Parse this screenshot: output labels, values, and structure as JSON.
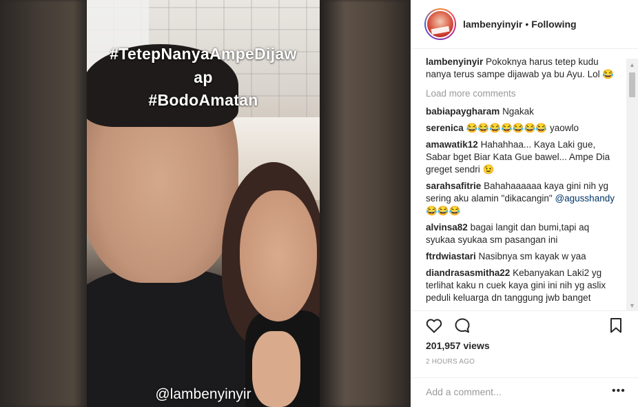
{
  "story": {
    "caption_line1": "#TetepNanyaAmpeDijaw",
    "caption_line2": "ap",
    "caption_line3": "#BodoAmatan",
    "handle": "@lambenyinyir"
  },
  "header": {
    "username": "lambenyinyir",
    "separator": "•",
    "follow_status": "Following"
  },
  "caption": {
    "username": "lambenyinyir",
    "text": "Pokoknya harus tetep kudu nanya terus sampe dijawab ya bu Ayu. Lol 😂"
  },
  "load_more": "Load more comments",
  "comments": [
    {
      "username": "babiapaygharam",
      "text": "Ngakak"
    },
    {
      "username": "serenica",
      "text": "😂😂😂😂😂😂😂 yaowlo"
    },
    {
      "username": "amawatik12",
      "text": "Hahahhaa... Kaya Laki gue, Sabar bget Biar Kata Gue bawel... Ampe Dia greget sendri 😉"
    },
    {
      "username": "sarahsafitrie",
      "text": "Bahahaaaaaa kaya gini nih yg sering aku alamin \"dikacangin\"",
      "mention": "@agusshandy",
      "after": "😂😂😂"
    },
    {
      "username": "alvinsa82",
      "text": "bagai langit dan bumi,tapi aq syukaa syukaa sm pasangan ini"
    },
    {
      "username": "ftrdwiastari",
      "text": "Nasibnya sm kayak w yaa"
    },
    {
      "username": "diandrasasmitha22",
      "text": "Kebanyakan Laki2 yg terlihat kaku n cuek kaya gini ini nih yg aslix peduli keluarga dn tanggung jwb banget"
    }
  ],
  "actions": {
    "views": "201,957 views",
    "time": "2 HOURS AGO",
    "add_comment_placeholder": "Add a comment...",
    "more": "•••"
  },
  "icons": {
    "like": "heart-icon",
    "comment": "comment-bubble-icon",
    "save": "bookmark-icon",
    "more": "more-options-icon"
  }
}
